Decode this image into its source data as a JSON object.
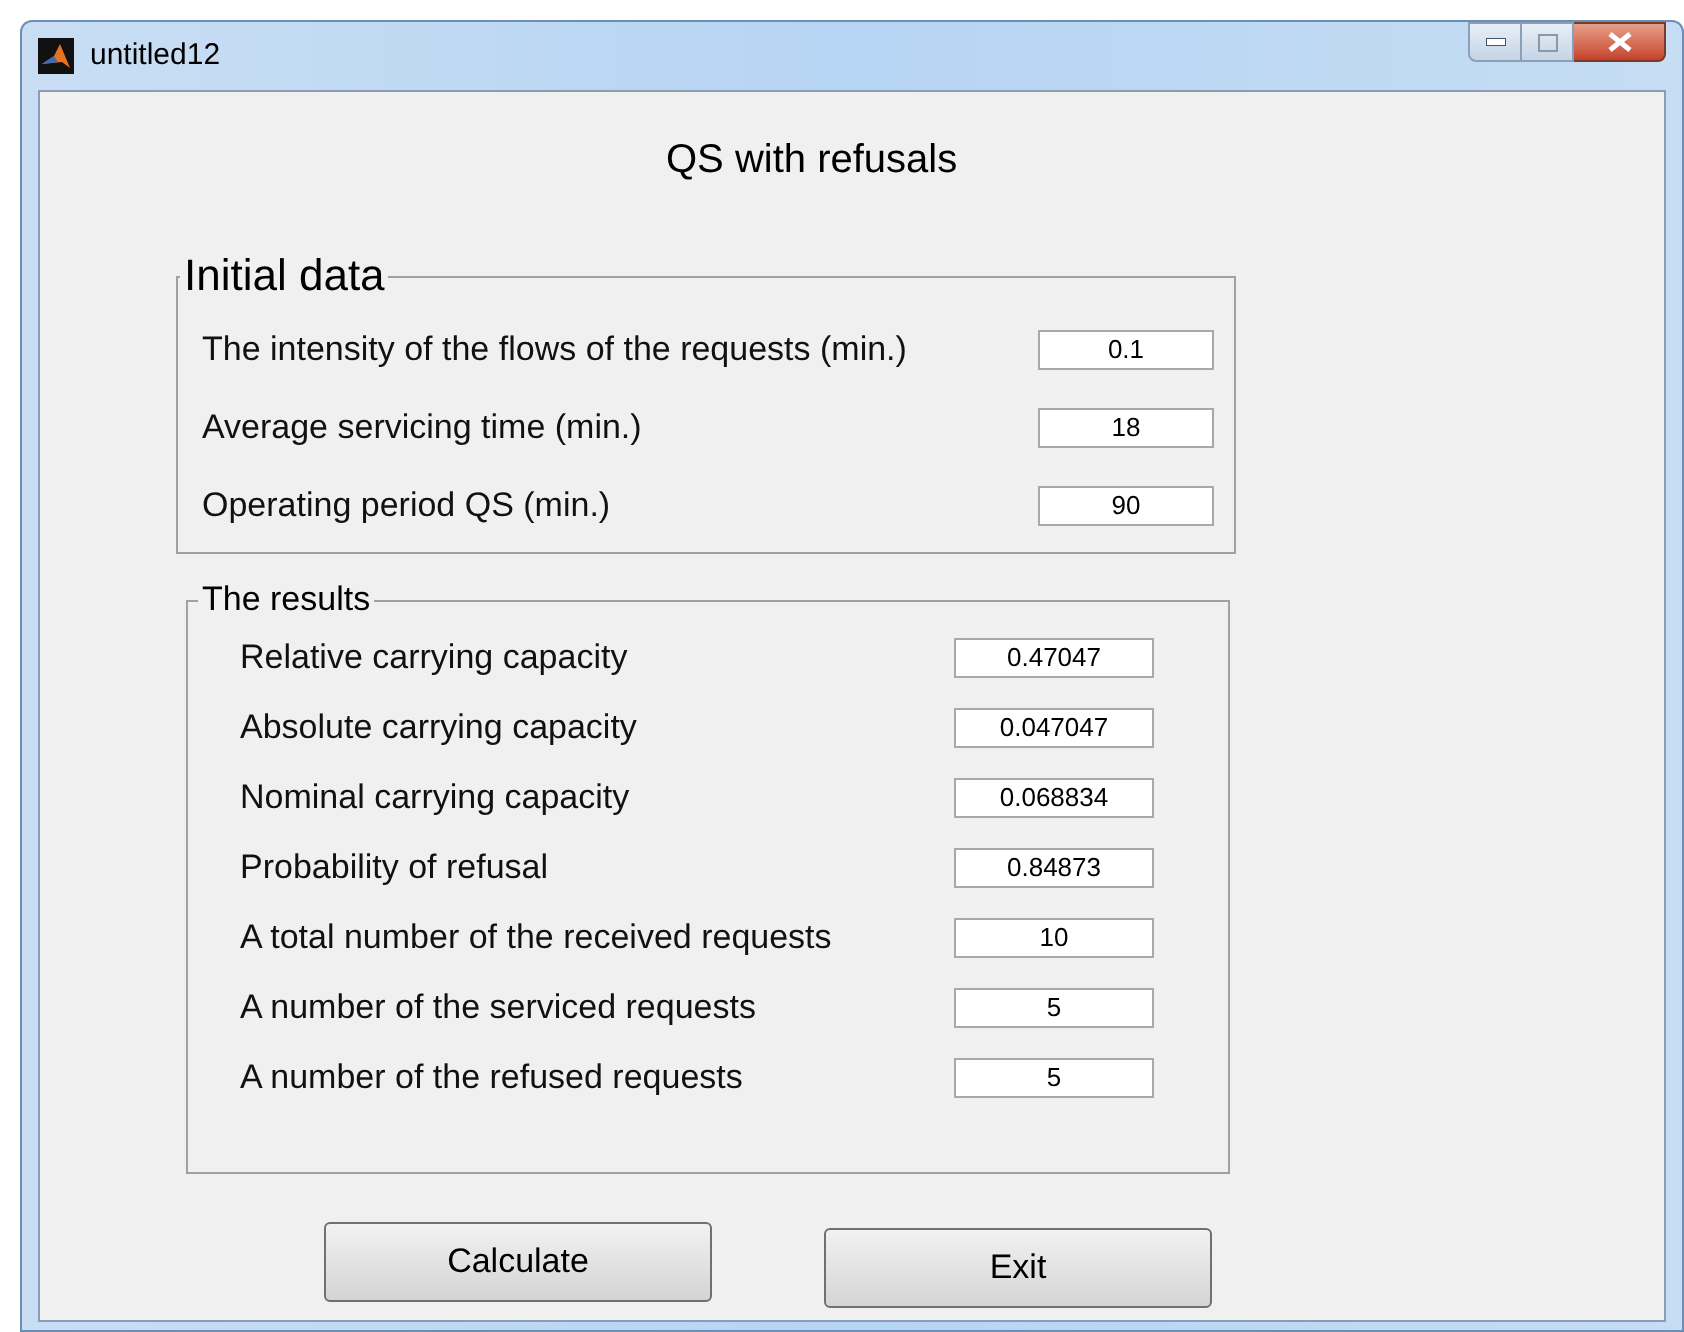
{
  "window": {
    "title": "untitled12"
  },
  "heading": "QS with refusals",
  "initial_data": {
    "title": "Initial data",
    "fields": [
      {
        "label": "The intensity of the flows of the requests (min.)",
        "value": "0.1"
      },
      {
        "label": "Average servicing time (min.)",
        "value": "18"
      },
      {
        "label": "Operating period QS (min.)",
        "value": "90"
      }
    ]
  },
  "results": {
    "title": "The results",
    "fields": [
      {
        "label": "Relative carrying capacity",
        "value": "0.47047"
      },
      {
        "label": "Absolute carrying capacity",
        "value": "0.047047"
      },
      {
        "label": "Nominal carrying capacity",
        "value": "0.068834"
      },
      {
        "label": "Probability of refusal",
        "value": "0.84873"
      },
      {
        "label": "A total number of the received requests",
        "value": "10"
      },
      {
        "label": "A number of the serviced requests",
        "value": "5"
      },
      {
        "label": "A number of the refused requests",
        "value": "5"
      }
    ]
  },
  "buttons": [
    "Calculate",
    "Exit"
  ]
}
